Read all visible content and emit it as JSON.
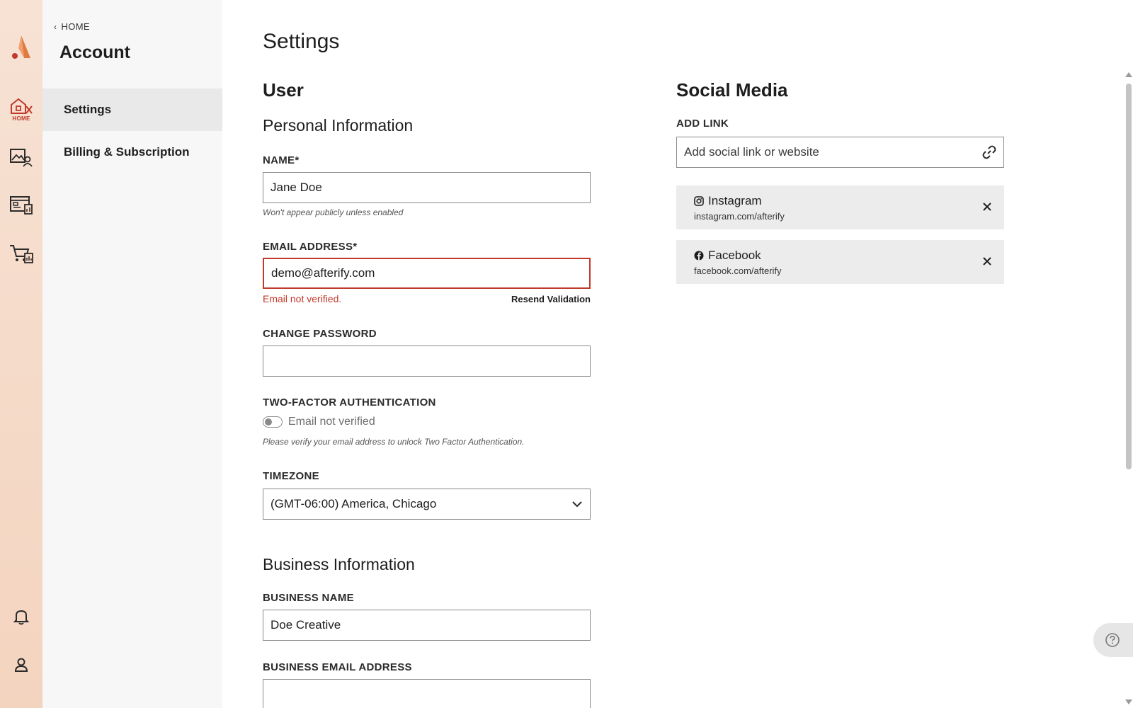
{
  "rail": {
    "home_caption": "HOME",
    "icons": [
      "logo-icon",
      "home-icon",
      "gallery-icon",
      "dashboard-icon",
      "cart-icon",
      "bell-icon",
      "user-icon"
    ]
  },
  "subnav": {
    "back_label": "HOME",
    "title": "Account",
    "items": [
      {
        "label": "Settings",
        "active": true
      },
      {
        "label": "Billing & Subscription",
        "active": false
      }
    ]
  },
  "page": {
    "title": "Settings"
  },
  "user": {
    "heading": "User",
    "personal": {
      "heading": "Personal Information",
      "name_label": "NAME*",
      "name_value": "Jane Doe",
      "name_hint": "Won't appear publicly unless enabled",
      "email_label": "EMAIL ADDRESS*",
      "email_value": "demo@afterify.com",
      "email_error": "Email not verified.",
      "resend_label": "Resend Validation",
      "password_label": "CHANGE PASSWORD",
      "password_value": "",
      "twofa_label": "TWO-FACTOR AUTHENTICATION",
      "twofa_status": "Email not verified",
      "twofa_hint": "Please verify your email address to unlock Two Factor Authentication.",
      "timezone_label": "TIMEZONE",
      "timezone_value": "(GMT-06:00) America, Chicago"
    },
    "business": {
      "heading": "Business Information",
      "name_label": "BUSINESS NAME",
      "name_value": "Doe Creative",
      "email_label": "BUSINESS EMAIL ADDRESS",
      "email_value": ""
    }
  },
  "social": {
    "heading": "Social Media",
    "add_label": "ADD LINK",
    "add_placeholder": "Add social link or website",
    "links": [
      {
        "name": "Instagram",
        "url": "instagram.com/afterify",
        "icon": "instagram-icon"
      },
      {
        "name": "Facebook",
        "url": "facebook.com/afterify",
        "icon": "facebook-icon"
      }
    ]
  },
  "colors": {
    "accent": "#c0392b",
    "logo": "#e07b3f",
    "rail_bg": "#f5d9c6"
  }
}
